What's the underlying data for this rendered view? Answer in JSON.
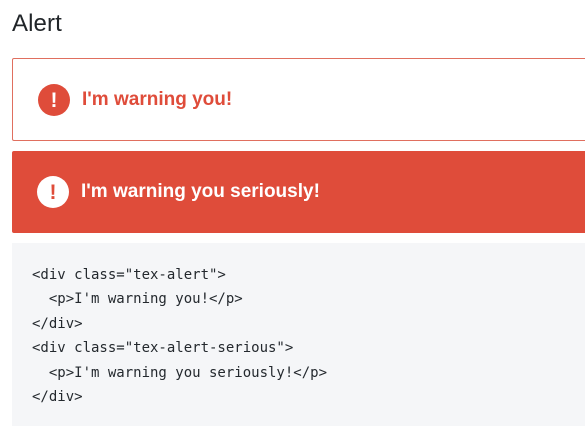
{
  "section": {
    "title": "Alert"
  },
  "alerts": [
    {
      "icon": "exclamation-icon",
      "icon_glyph": "!",
      "text": "I'm warning you!"
    },
    {
      "icon": "exclamation-icon",
      "icon_glyph": "!",
      "text": "I'm warning you seriously!"
    }
  ],
  "colors": {
    "accent": "#df4c3a",
    "code_background": "#f5f6f8",
    "text": "#212529"
  },
  "code": {
    "lines": [
      "<div class=\"tex-alert\">",
      "  <p>I'm warning you!</p>",
      "</div>",
      "<div class=\"tex-alert-serious\">",
      "  <p>I'm warning you seriously!</p>",
      "</div>"
    ]
  }
}
